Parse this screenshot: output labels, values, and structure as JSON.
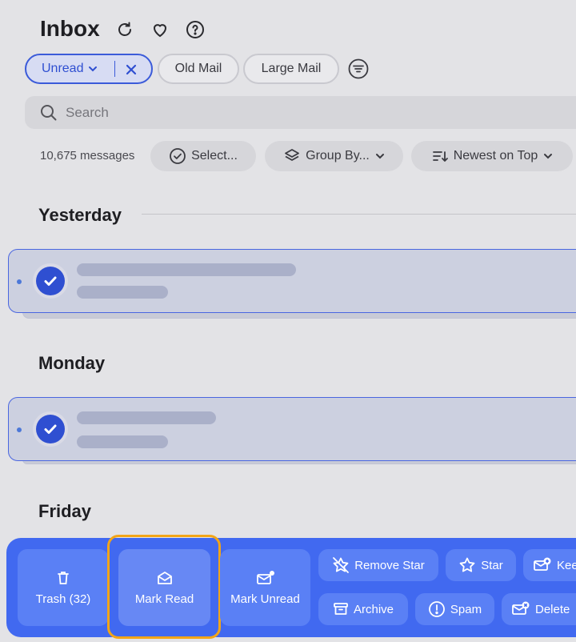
{
  "header": {
    "title": "Inbox"
  },
  "filters": {
    "unread_label": "Unread",
    "old_mail_label": "Old Mail",
    "large_mail_label": "Large Mail"
  },
  "search": {
    "placeholder": "Search"
  },
  "list_toolbar": {
    "count": "10,675 messages",
    "select_label": "Select...",
    "group_by_label": "Group By...",
    "sort_label": "Newest on Top"
  },
  "groups": [
    {
      "day": "Yesterday"
    },
    {
      "day": "Monday"
    },
    {
      "day": "Friday"
    }
  ],
  "actions": {
    "trash_label": "Trash (32)",
    "mark_read_label": "Mark Read",
    "mark_unread_label": "Mark Unread",
    "remove_star_label": "Remove Star",
    "star_label": "Star",
    "keep_label": "Kee",
    "archive_label": "Archive",
    "spam_label": "Spam",
    "delete_label": "Delete"
  },
  "colors": {
    "accent": "#3b5bd9",
    "toolbar_bg": "#4169f0",
    "highlight": "#f2a518"
  }
}
